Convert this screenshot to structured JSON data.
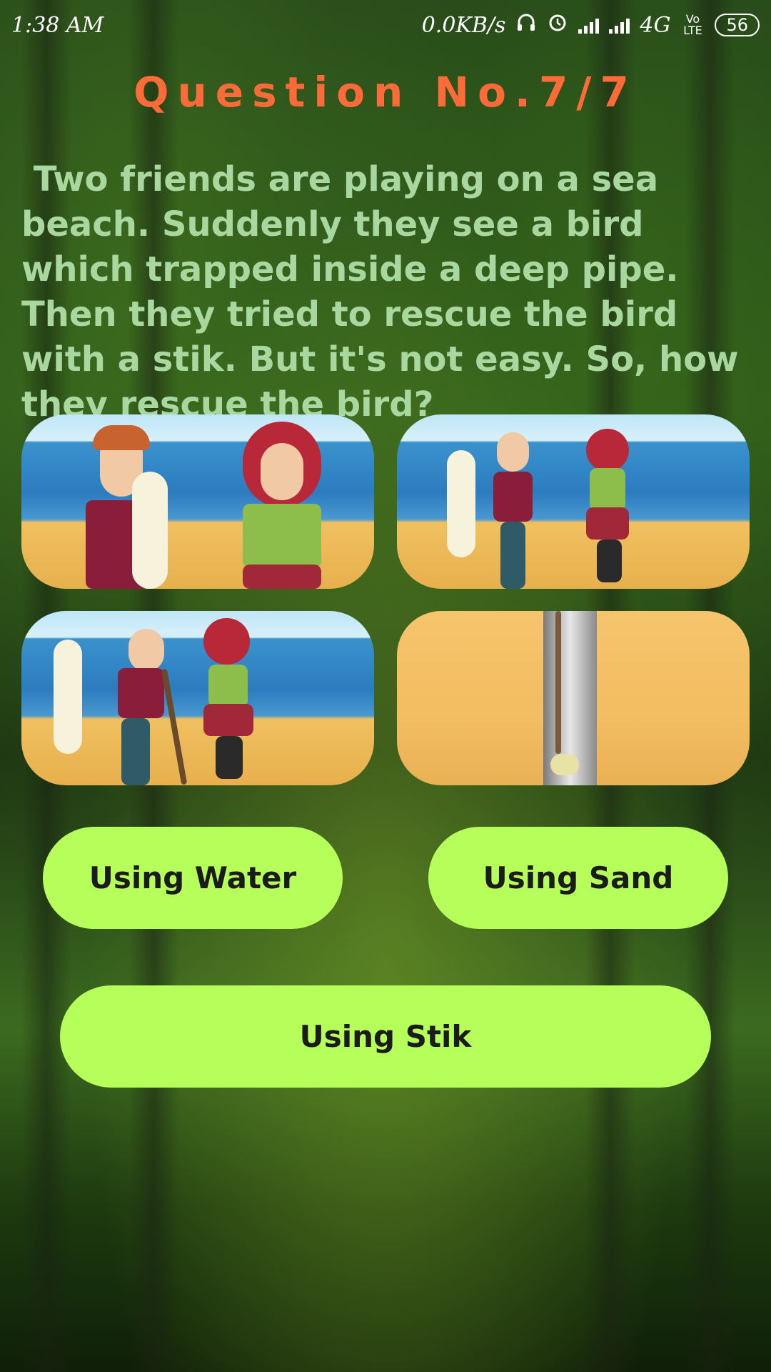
{
  "status_bar": {
    "time": "1:38 AM",
    "net_speed": "0.0KB/s",
    "network": "4G",
    "volte": "Vo LTE",
    "battery": "56",
    "icons": [
      "headset-icon",
      "alarm-icon",
      "signal-icon",
      "signal-icon",
      "battery-icon"
    ]
  },
  "quiz": {
    "title": "Question No.7/7",
    "question": " Two friends are playing on a sea beach. Suddenly they see a bird which trapped inside a deep pipe. Then they tried to rescue the bird with a stik. But it's not easy. So, how they rescue the bird?",
    "options": [
      "Using Water",
      "Using Sand",
      "Using Stik"
    ]
  },
  "colors": {
    "title": "#ff6b38",
    "question_text": "#a8d8a0",
    "option_button": "#b6ff5a"
  }
}
